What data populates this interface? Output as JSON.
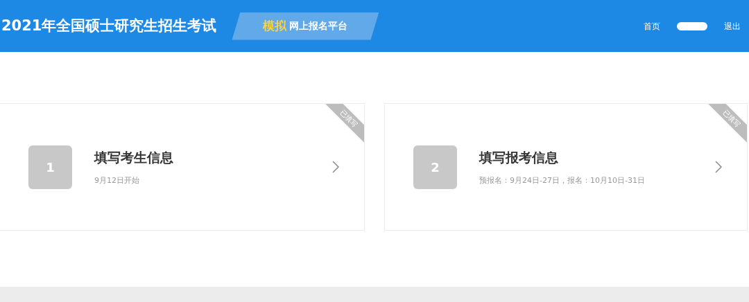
{
  "header": {
    "title": "2021年全国硕士研究生招生考试",
    "badge_highlight": "模拟",
    "badge_text": "网上报名平台",
    "nav": [
      {
        "label": "首页",
        "kind": "link"
      },
      {
        "kind": "redacted"
      },
      {
        "label": "退出",
        "kind": "link"
      }
    ]
  },
  "steps": [
    {
      "number": "1",
      "title": "填写考生信息",
      "subtitle": "9月12日开始",
      "ribbon": "已填写"
    },
    {
      "number": "2",
      "title": "填写报考信息",
      "subtitle": "预报名：9月24日-27日，报名：10月10日-31日",
      "ribbon": "已填写"
    }
  ]
}
